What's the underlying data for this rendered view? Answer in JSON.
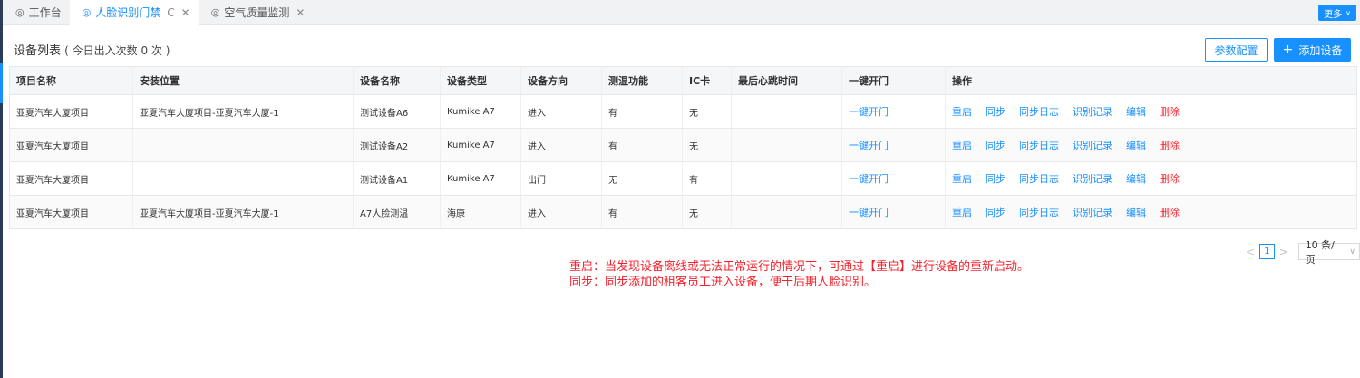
{
  "tabs": [
    {
      "icon": "◎",
      "label": "工作台",
      "active": false
    },
    {
      "icon": "◎",
      "label": "人脸识别门禁",
      "active": true,
      "refresh": "C",
      "close": "✕"
    },
    {
      "icon": "◎",
      "label": "空气质量监测",
      "active": false,
      "close": "✕"
    }
  ],
  "more_button": {
    "label": "更多",
    "chevron": "∨"
  },
  "header": {
    "title": "设备列表",
    "subtitle": "( 今日出入次数 0 次 )"
  },
  "buttons": {
    "config": "参数配置",
    "add_plus": "+",
    "add": "添加设备"
  },
  "table": {
    "columns": [
      "项目名称",
      "安装位置",
      "设备名称",
      "设备类型",
      "设备方向",
      "测温功能",
      "IC卡",
      "最后心跳时间",
      "一键开门",
      "操作"
    ],
    "rows": [
      {
        "project": "亚夏汽车大厦项目",
        "location": "亚夏汽车大厦项目-亚夏汽车大厦-1",
        "name": "测试设备A6",
        "type": "Kumike A7",
        "direction": "进入",
        "temp": "有",
        "ic": "无",
        "heartbeat": "",
        "open": "一键开门"
      },
      {
        "project": "亚夏汽车大厦项目",
        "location": "",
        "name": "测试设备A2",
        "type": "Kumike A7",
        "direction": "进入",
        "temp": "有",
        "ic": "无",
        "heartbeat": "",
        "open": "一键开门"
      },
      {
        "project": "亚夏汽车大厦项目",
        "location": "",
        "name": "测试设备A1",
        "type": "Kumike A7",
        "direction": "出门",
        "temp": "无",
        "ic": "有",
        "heartbeat": "",
        "open": "一键开门"
      },
      {
        "project": "亚夏汽车大厦项目",
        "location": "亚夏汽车大厦项目-亚夏汽车大厦-1",
        "name": "A7人脸测温",
        "type": "海康",
        "direction": "进入",
        "temp": "有",
        "ic": "无",
        "heartbeat": "",
        "open": "一键开门"
      }
    ],
    "actions": [
      "重启",
      "同步",
      "同步日志",
      "识别记录",
      "编辑",
      "删除"
    ]
  },
  "pagination": {
    "prev": "<",
    "current": "1",
    "next": ">",
    "page_size": "10 条/页",
    "chevron": "∨"
  },
  "notes": [
    "重启：当发现设备离线或无法正常运行的情况下，可通过【重启】进行设备的重新启动。",
    "同步：同步添加的租客员工进入设备，便于后期人脸识别。"
  ],
  "colors": {
    "primary": "#1890ff",
    "danger": "#f5222d",
    "sidebar": "#2b3a55"
  }
}
